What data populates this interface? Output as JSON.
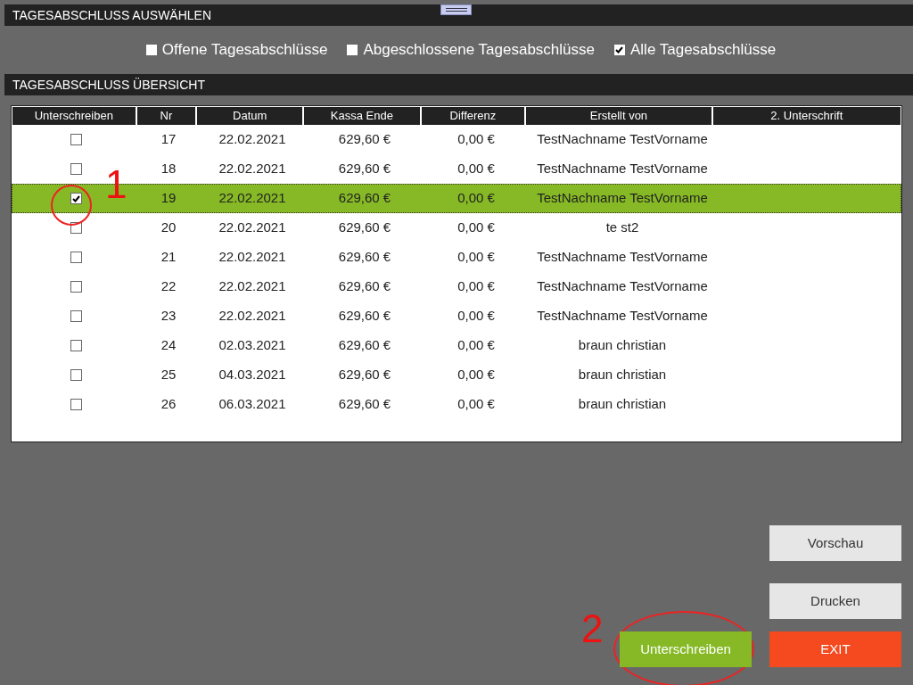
{
  "sections": [
    {
      "title": "TAGESABSCHLUSS AUSWÄHLEN"
    },
    {
      "title": "TAGESABSCHLUSS ÜBERSICHT"
    }
  ],
  "filters": [
    {
      "label": "Offene Tagesabschlüsse",
      "checked": false
    },
    {
      "label": "Abgeschlossene Tagesabschlüsse",
      "checked": false
    },
    {
      "label": "Alle Tagesabschlüsse",
      "checked": true
    }
  ],
  "table": {
    "columns": [
      "Unterschreiben",
      "Nr",
      "Datum",
      "Kassa Ende",
      "Differenz",
      "Erstellt von",
      "2. Unterschrift"
    ],
    "rows": [
      {
        "checked": false,
        "selected": false,
        "nr": "17",
        "datum": "22.02.2021",
        "kassa_ende": "629,60 €",
        "differenz": "0,00 €",
        "erstellt_von": "TestNachname TestVorname"
      },
      {
        "checked": false,
        "selected": false,
        "nr": "18",
        "datum": "22.02.2021",
        "kassa_ende": "629,60 €",
        "differenz": "0,00 €",
        "erstellt_von": "TestNachname TestVorname"
      },
      {
        "checked": true,
        "selected": true,
        "nr": "19",
        "datum": "22.02.2021",
        "kassa_ende": "629,60 €",
        "differenz": "0,00 €",
        "erstellt_von": "TestNachname TestVorname"
      },
      {
        "checked": false,
        "selected": false,
        "nr": "20",
        "datum": "22.02.2021",
        "kassa_ende": "629,60 €",
        "differenz": "0,00 €",
        "erstellt_von": "te st2"
      },
      {
        "checked": false,
        "selected": false,
        "nr": "21",
        "datum": "22.02.2021",
        "kassa_ende": "629,60 €",
        "differenz": "0,00 €",
        "erstellt_von": "TestNachname TestVorname"
      },
      {
        "checked": false,
        "selected": false,
        "nr": "22",
        "datum": "22.02.2021",
        "kassa_ende": "629,60 €",
        "differenz": "0,00 €",
        "erstellt_von": "TestNachname TestVorname"
      },
      {
        "checked": false,
        "selected": false,
        "nr": "23",
        "datum": "22.02.2021",
        "kassa_ende": "629,60 €",
        "differenz": "0,00 €",
        "erstellt_von": "TestNachname TestVorname"
      },
      {
        "checked": false,
        "selected": false,
        "nr": "24",
        "datum": "02.03.2021",
        "kassa_ende": "629,60 €",
        "differenz": "0,00 €",
        "erstellt_von": "braun christian"
      },
      {
        "checked": false,
        "selected": false,
        "nr": "25",
        "datum": "04.03.2021",
        "kassa_ende": "629,60 €",
        "differenz": "0,00 €",
        "erstellt_von": "braun christian"
      },
      {
        "checked": false,
        "selected": false,
        "nr": "26",
        "datum": "06.03.2021",
        "kassa_ende": "629,60 €",
        "differenz": "0,00 €",
        "erstellt_von": "braun christian"
      }
    ]
  },
  "buttons": [
    {
      "label": "Vorschau",
      "kind": "plain"
    },
    {
      "label": "Drucken",
      "kind": "plain"
    },
    {
      "label": "Unterschreiben",
      "kind": "confirm"
    },
    {
      "label": "EXIT",
      "kind": "exit"
    }
  ],
  "annotations": [
    {
      "label": "1"
    },
    {
      "label": "2"
    }
  ]
}
